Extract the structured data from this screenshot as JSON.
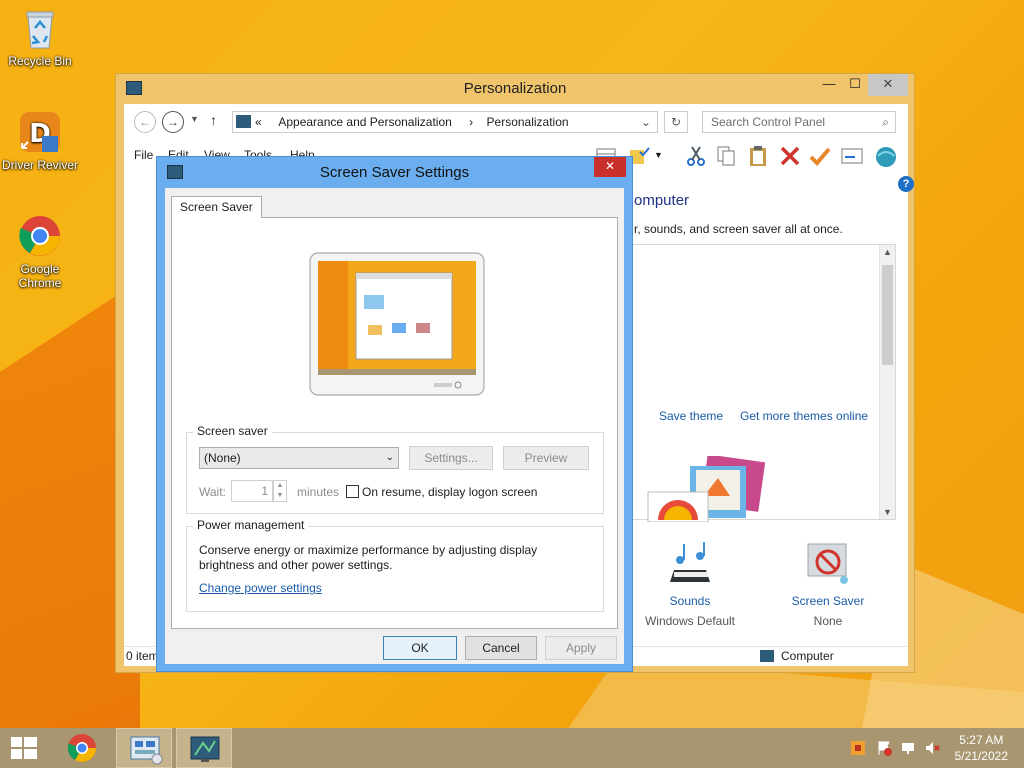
{
  "desktop": {
    "icons": [
      {
        "label": "Recycle Bin"
      },
      {
        "label": "Driver Reviver"
      },
      {
        "label": "Google Chrome"
      }
    ]
  },
  "window": {
    "title": "Personalization",
    "address": {
      "prefix": "«",
      "crumb1": "Appearance and Personalization",
      "crumb2": "Personalization"
    },
    "search_placeholder": "Search Control Panel",
    "menu": [
      "File",
      "Edit",
      "View",
      "Tools",
      "Help"
    ],
    "heading": "omputer",
    "description": "r, sounds, and screen saver all at once.",
    "save_theme": "Save theme",
    "more_themes": "Get more themes online",
    "bottom": {
      "sounds": {
        "label": "Sounds",
        "value": "Windows Default"
      },
      "screen_saver": {
        "label": "Screen Saver",
        "value": "None"
      }
    },
    "status_left": "0 item",
    "status_right": "Computer",
    "help_glyph": "?"
  },
  "dialog": {
    "title": "Screen Saver Settings",
    "tab": "Screen Saver",
    "screen_saver_group": "Screen saver",
    "selected": "(None)",
    "settings_btn": "Settings...",
    "preview_btn": "Preview",
    "wait_label": "Wait:",
    "wait_value": "1",
    "minutes_label": "minutes",
    "resume_label": "On resume, display logon screen",
    "power_group": "Power management",
    "power_text_1": "Conserve energy or maximize performance by adjusting display",
    "power_text_2": "brightness and other power settings.",
    "power_link": "Change power settings",
    "ok": "OK",
    "cancel": "Cancel",
    "apply": "Apply",
    "close_glyph": "✕"
  },
  "taskbar": {
    "time": "5:27 AM",
    "date": "5/21/2022"
  },
  "colors": {
    "accent": "#6aaef0",
    "link": "#1a5ca8",
    "taskbar": "#a89670",
    "wallpaper": "#f6b012"
  }
}
